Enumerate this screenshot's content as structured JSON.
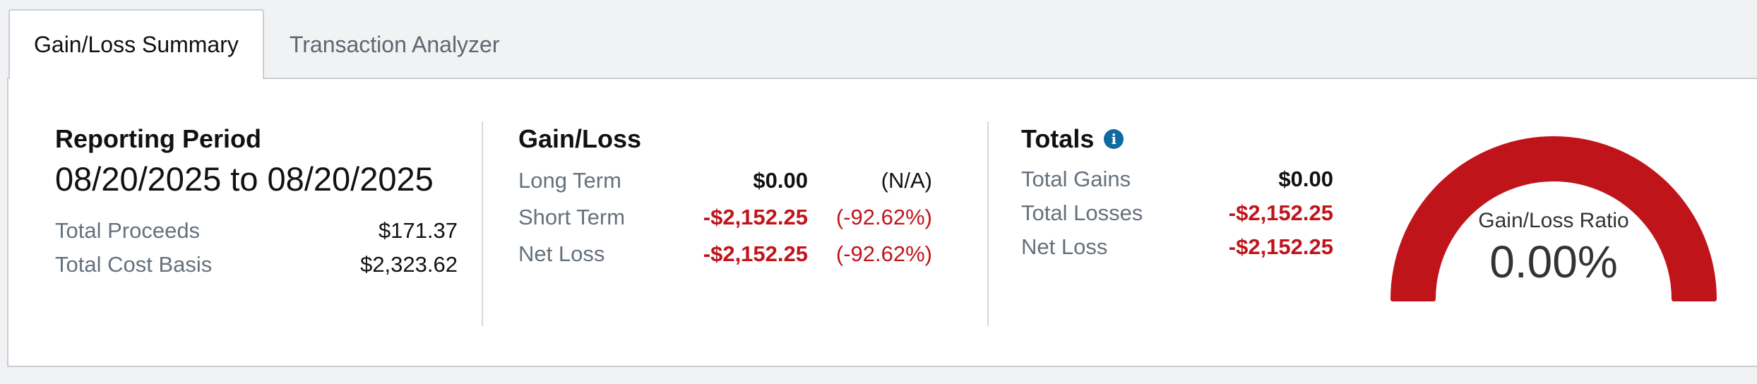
{
  "tabs": [
    {
      "label": "Gain/Loss Summary",
      "active": true
    },
    {
      "label": "Transaction Analyzer",
      "active": false
    }
  ],
  "reporting_period": {
    "heading": "Reporting Period",
    "range": "08/20/2025 to 08/20/2025",
    "rows": [
      {
        "label": "Total Proceeds",
        "value": "$171.37"
      },
      {
        "label": "Total Cost Basis",
        "value": "$2,323.62"
      }
    ]
  },
  "gain_loss": {
    "heading": "Gain/Loss",
    "rows": [
      {
        "label": "Long Term",
        "value": "$0.00",
        "percent": "(N/A)"
      },
      {
        "label": "Short Term",
        "value": "-$2,152.25",
        "percent": "(-92.62%)"
      },
      {
        "label": "Net Loss",
        "value": "-$2,152.25",
        "percent": "(-92.62%)"
      }
    ]
  },
  "totals": {
    "heading": "Totals",
    "info_icon": "info-icon",
    "rows": [
      {
        "label": "Total Gains",
        "value": "$0.00"
      },
      {
        "label": "Total Losses",
        "value": "-$2,152.25"
      },
      {
        "label": "Net Loss",
        "value": "-$2,152.25"
      }
    ]
  },
  "gauge": {
    "label": "Gain/Loss Ratio",
    "value": "0.00%",
    "ratio": 0.0
  },
  "colors": {
    "negative": "#c0141b",
    "gauge_fill": "#c0141b",
    "info": "#0f6aa1"
  }
}
